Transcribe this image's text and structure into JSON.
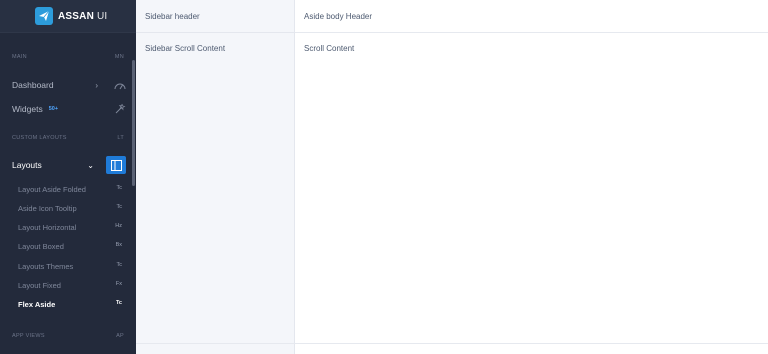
{
  "brand": {
    "name": "ASSAN",
    "suffix": "UI"
  },
  "nav": {
    "section_main": {
      "label": "MAIN",
      "short": "MN"
    },
    "dashboard": {
      "label": "Dashboard"
    },
    "widgets": {
      "label": "Widgets",
      "badge": "50+"
    },
    "section_custom": {
      "label": "CUSTOM LAYOUTS",
      "short": "LT"
    },
    "layouts": {
      "label": "Layouts"
    },
    "submenu": [
      {
        "label": "Layout Aside Folded",
        "short": "Tc"
      },
      {
        "label": "Aside Icon Tooltip",
        "short": "Tc"
      },
      {
        "label": "Layout Horizontal",
        "short": "Hz"
      },
      {
        "label": "Layout Boxed",
        "short": "Bx"
      },
      {
        "label": "Layouts Themes",
        "short": "Tc"
      },
      {
        "label": "Layout Fixed",
        "short": "Fx"
      },
      {
        "label": "Flex Aside",
        "short": "Tc"
      }
    ],
    "section_app": {
      "label": "APP VIEWS",
      "short": "AP"
    }
  },
  "sidebar": {
    "header": "Sidebar header",
    "content": "Sidebar Scroll Content"
  },
  "aside": {
    "header": "Aside body Header",
    "content": "Scroll Content"
  },
  "colors": {
    "nav_bg": "#232a3b",
    "accent": "#1f7bd8",
    "badge": "#4fa6ff"
  }
}
